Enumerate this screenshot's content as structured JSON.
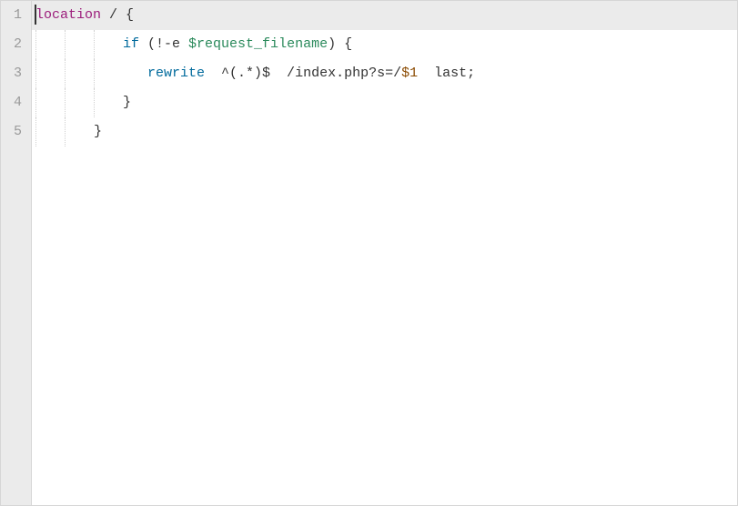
{
  "editor": {
    "active_line": 1,
    "cursor": {
      "line": 1,
      "col": 1
    },
    "lines": [
      {
        "n": 1,
        "indent": 0,
        "tokens": {
          "t0": "location",
          "t1": " / {"
        }
      },
      {
        "n": 2,
        "indent": 3,
        "tokens": {
          "t0": "if",
          "t1": " (!-e ",
          "t2": "$request_filename",
          "t3": ") {"
        }
      },
      {
        "n": 3,
        "indent": 3,
        "tokens": {
          "t0": "   ",
          "t1": "rewrite",
          "t2": "  ^(.*)$  /index.php?s=/",
          "t3": "$1",
          "t4": "  last;"
        }
      },
      {
        "n": 4,
        "indent": 3,
        "tokens": {
          "t0": "}"
        }
      },
      {
        "n": 5,
        "indent": 2,
        "tokens": {
          "t0": "}"
        }
      }
    ]
  },
  "colors": {
    "gutter_bg": "#ebebeb",
    "code_bg": "#ffffff",
    "active_line_bg": "#ebebeb",
    "keyword": "#9c1e7c",
    "builtin": "#006a9c",
    "variable": "#2b8a5c"
  }
}
